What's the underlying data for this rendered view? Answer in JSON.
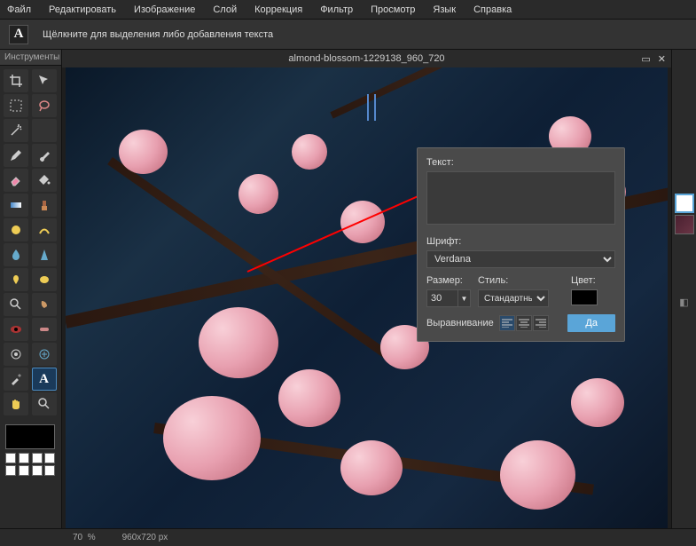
{
  "menu": {
    "file": "Файл",
    "edit": "Редактировать",
    "image": "Изображение",
    "layer": "Слой",
    "adjust": "Коррекция",
    "filter": "Фильтр",
    "view": "Просмотр",
    "lang": "Язык",
    "help": "Справка"
  },
  "toolbar": {
    "active_tool_glyph": "A",
    "hint": "Щёлкните для выделения либо добавления текста"
  },
  "tools_panel": {
    "title": "Инструменты"
  },
  "canvas": {
    "title": "almond-blossom-1229138_960_720"
  },
  "dialog": {
    "text_label": "Текст:",
    "text_value": "",
    "font_label": "Шрифт:",
    "font_value": "Verdana",
    "size_label": "Размер:",
    "size_value": "30",
    "style_label": "Стиль:",
    "style_value": "Стандартный",
    "color_label": "Цвет:",
    "color_value": "#000000",
    "align_label": "Выравнивание",
    "ok": "Да"
  },
  "status": {
    "zoom": "70",
    "zoom_unit": "%",
    "dimensions": "960x720 px"
  }
}
